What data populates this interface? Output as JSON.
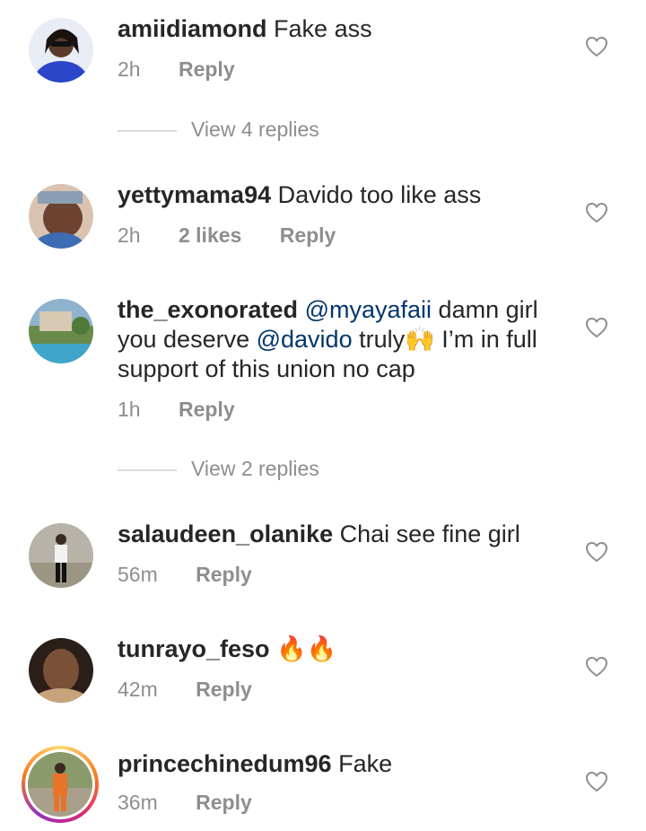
{
  "comments": [
    {
      "username": "amiidiamond",
      "text": "Fake ass",
      "time": "2h",
      "reply": "Reply"
    },
    {
      "username": "yettymama94",
      "text": "Davido too like ass",
      "time": "2h",
      "likes": "2 likes",
      "reply": "Reply"
    },
    {
      "username": "the_exonorated",
      "mention1": "@myayafaii",
      "text1": "damn girl you deserve",
      "mention2": "@davido",
      "text2": "truly🙌 I’m in full support of this union no cap",
      "time": "1h",
      "reply": "Reply"
    },
    {
      "username": "salaudeen_olanike",
      "text": "Chai see fine girl",
      "time": "56m",
      "reply": "Reply"
    },
    {
      "username": "tunrayo_feso",
      "text": "🔥🔥",
      "time": "42m",
      "reply": "Reply"
    },
    {
      "username": "princechinedum96",
      "text": "Fake",
      "time": "36m",
      "reply": "Reply"
    }
  ],
  "view_replies": [
    "View 4 replies",
    "View 2 replies"
  ],
  "icons": {
    "like": "heart-outline-icon"
  },
  "colors": {
    "text": "#262626",
    "muted": "#8e8e8e",
    "mention": "#00376b"
  }
}
